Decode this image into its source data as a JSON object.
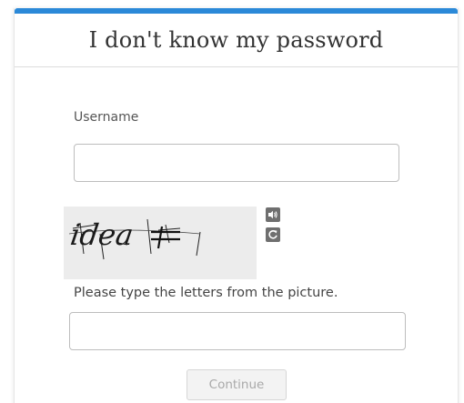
{
  "header": {
    "title": "I don't know my password",
    "accent_color": "#2b89d8"
  },
  "form": {
    "username_label": "Username",
    "username_value": "",
    "captcha": {
      "text": "idea",
      "audio_icon": "speaker-icon",
      "refresh_icon": "refresh-icon"
    },
    "captcha_hint": "Please type the letters from the picture.",
    "captcha_value": "",
    "continue_label": "Continue",
    "continue_disabled": true
  }
}
